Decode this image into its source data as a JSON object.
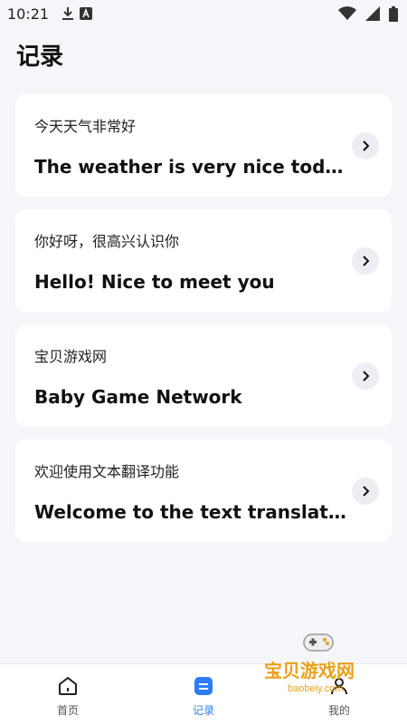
{
  "status": {
    "time": "10:21"
  },
  "header": {
    "title": "记录"
  },
  "records": [
    {
      "source": "今天天气非常好",
      "translation": "The weather is very nice today"
    },
    {
      "source": "你好呀，很高兴认识你",
      "translation": "Hello! Nice to meet you"
    },
    {
      "source": "宝贝游戏网",
      "translation": "Baby Game Network"
    },
    {
      "source": "欢迎使用文本翻译功能",
      "translation": "Welcome to the text translation function"
    }
  ],
  "tabs": [
    {
      "label": "首页",
      "icon": "home-icon",
      "active": false
    },
    {
      "label": "记录",
      "icon": "records-icon",
      "active": true
    },
    {
      "label": "我的",
      "icon": "profile-icon",
      "active": false
    }
  ],
  "watermark": {
    "text": "宝贝游戏网",
    "url": "baobeiy.com"
  },
  "colors": {
    "accent": "#2e7cf6",
    "background": "#f4f6f9",
    "watermark": "#e8a11a"
  }
}
